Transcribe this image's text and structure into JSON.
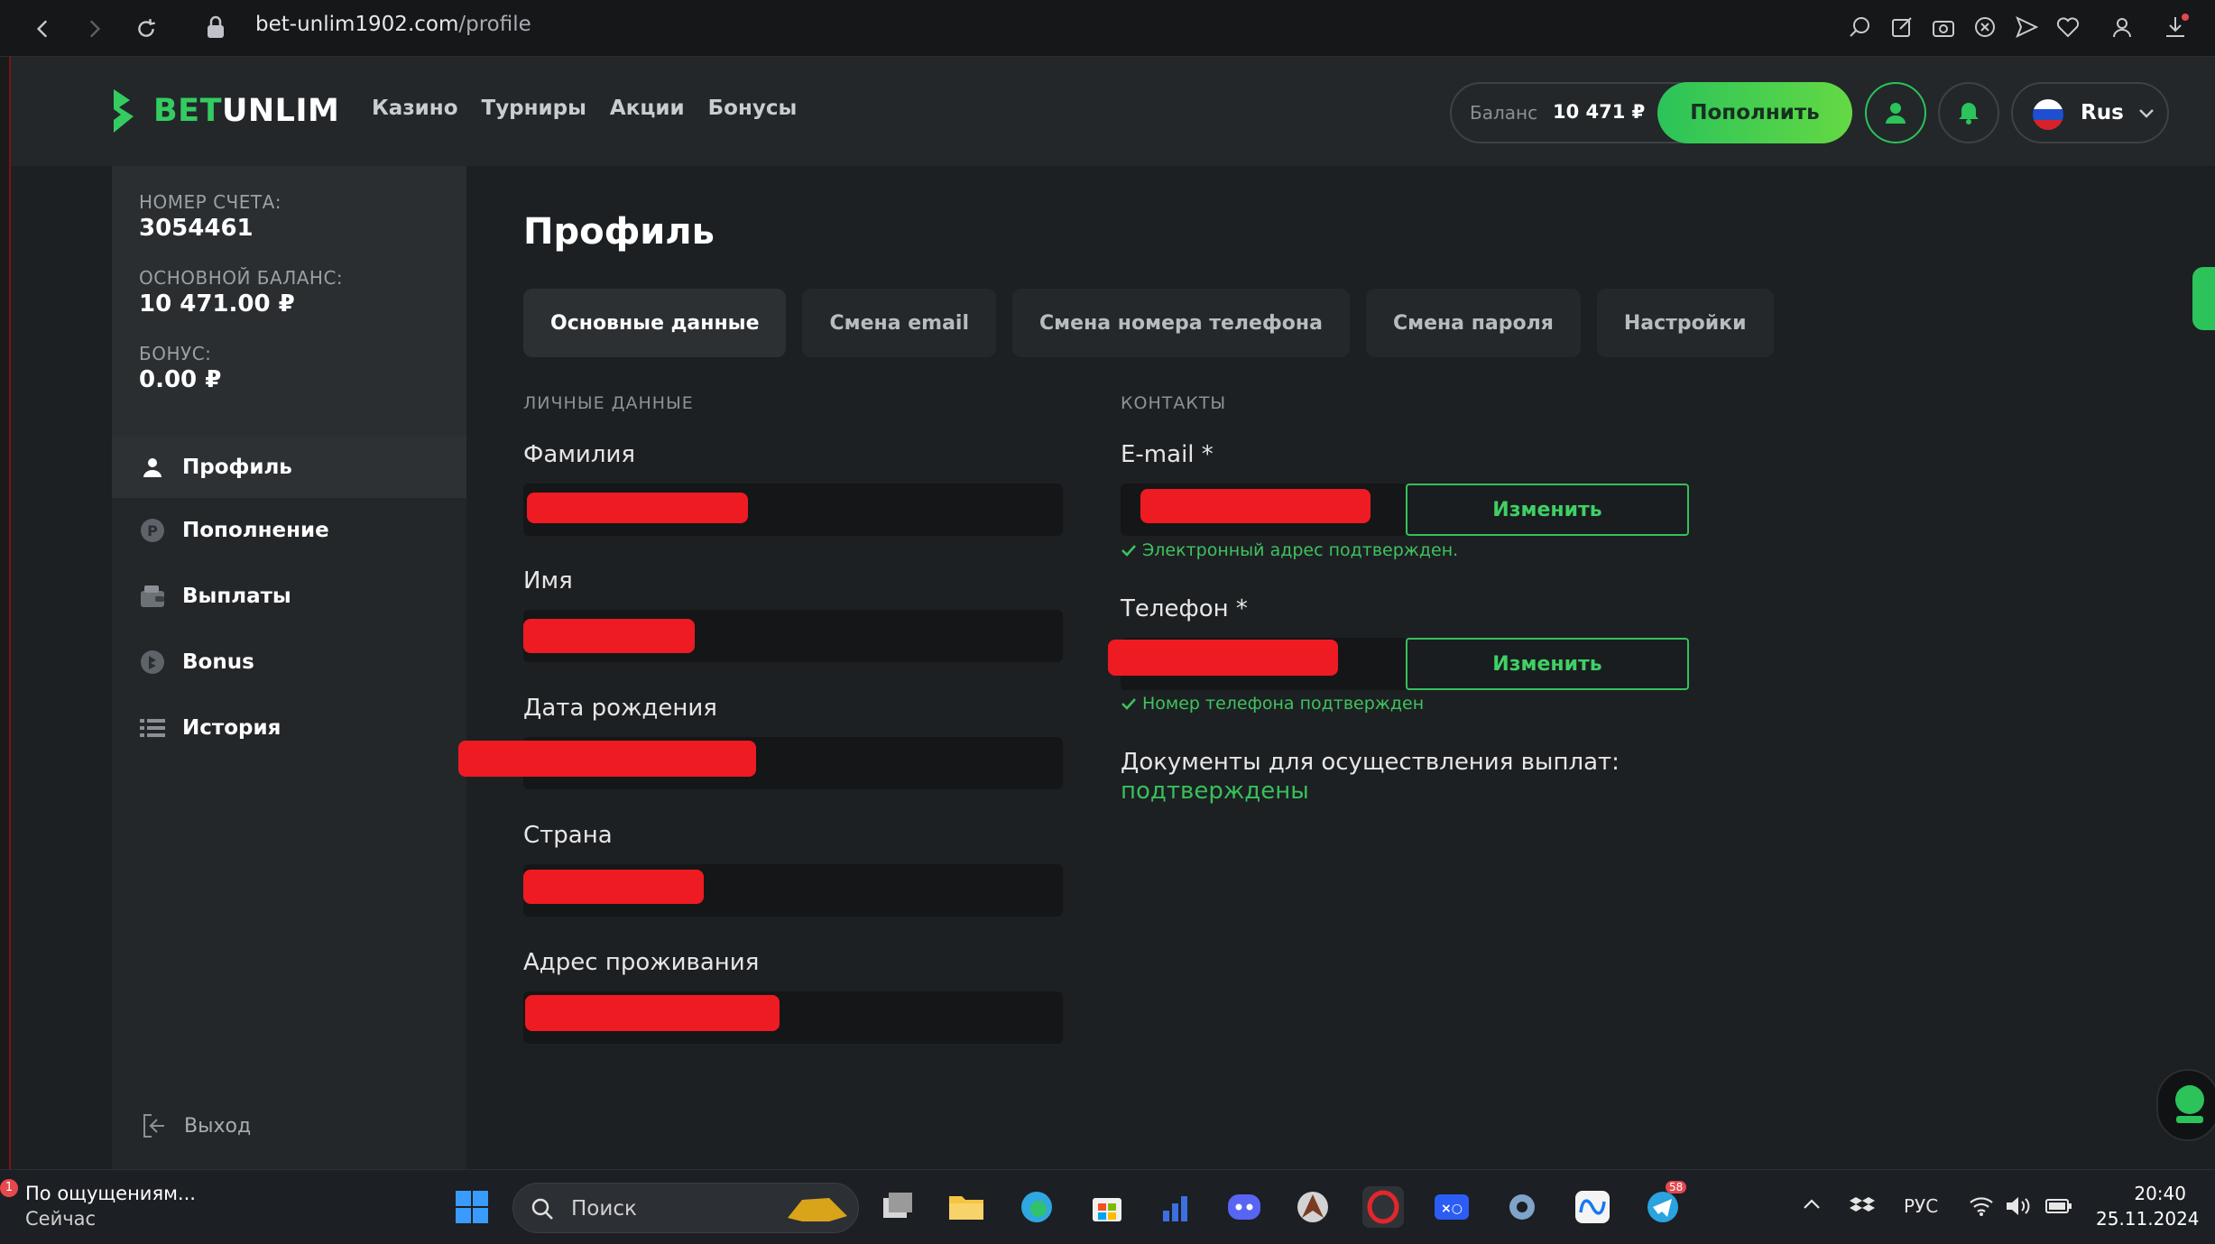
{
  "browser": {
    "url_host": "bet-unlim1902.com",
    "url_path": "/profile"
  },
  "header": {
    "logo_text": "BETUNLIM",
    "nav": [
      "Казино",
      "Турниры",
      "Акции",
      "Бонусы"
    ],
    "balance_label": "Баланс",
    "balance_value": "10 471 ₽",
    "topup_label": "Пополнить",
    "lang_label": "Rus"
  },
  "sidebar": {
    "account_number_label": "НОМЕР СЧЕТА:",
    "account_number": "3054461",
    "main_balance_label": "ОСНОВНОЙ БАЛАНС:",
    "main_balance": "10 471.00 ₽",
    "bonus_label": "БОНУС:",
    "bonus": "0.00 ₽",
    "items": [
      {
        "label": "Профиль",
        "icon": "user-icon"
      },
      {
        "label": "Пополнение",
        "icon": "ruble-coin-icon"
      },
      {
        "label": "Выплаты",
        "icon": "wallet-icon"
      },
      {
        "label": "Bonus",
        "icon": "bonus-coin-icon"
      },
      {
        "label": "История",
        "icon": "list-icon"
      }
    ],
    "logout_label": "Выход"
  },
  "main": {
    "title": "Профиль",
    "tabs": [
      "Основные данные",
      "Смена email",
      "Смена номера телефона",
      "Смена пароля",
      "Настройки"
    ],
    "personal": {
      "section": "ЛИЧНЫЕ ДАННЫЕ",
      "surname_label": "Фамилия",
      "name_label": "Имя",
      "birth_label": "Дата рождения",
      "country_label": "Страна",
      "address_label": "Адрес проживания"
    },
    "contacts": {
      "section": "КОНТАКТЫ",
      "email_label": "E-mail *",
      "email_change": "Изменить",
      "email_status": "Электронный адрес подтвержден.",
      "phone_label": "Телефон *",
      "phone_change": "Изменить",
      "phone_status": "Номер телефона подтвержден",
      "docs_label": "Документы для осуществления выплат:",
      "docs_status": "подтверждены"
    }
  },
  "taskbar": {
    "notif_title": "По ощущениям...",
    "notif_sub": "Сейчас",
    "notif_count": "1",
    "search_label": "Поиск",
    "telegram_badge": "58",
    "lang": "РУС",
    "time": "20:40",
    "date": "25.11.2024"
  },
  "colors": {
    "accent": "#2bc35a",
    "redaction": "#ef1b22"
  }
}
